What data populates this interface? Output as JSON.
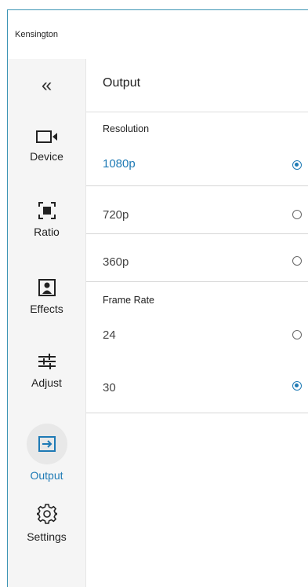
{
  "app": {
    "title": "Kensington"
  },
  "sidebar": {
    "collapse_glyph": "«",
    "items": [
      {
        "label": "Device",
        "icon": "camera-icon"
      },
      {
        "label": "Ratio",
        "icon": "ratio-icon"
      },
      {
        "label": "Effects",
        "icon": "portrait-icon"
      },
      {
        "label": "Adjust",
        "icon": "sliders-icon"
      },
      {
        "label": "Output",
        "icon": "output-icon",
        "active": true
      },
      {
        "label": "Settings",
        "icon": "gear-icon"
      }
    ]
  },
  "main": {
    "title": "Output",
    "resolution": {
      "label": "Resolution",
      "options": [
        {
          "label": "1080p",
          "selected": true
        },
        {
          "label": "720p",
          "selected": false
        },
        {
          "label": "360p",
          "selected": false
        }
      ]
    },
    "frame_rate": {
      "label": "Frame Rate",
      "options": [
        {
          "label": "24",
          "selected": false
        },
        {
          "label": "30",
          "selected": true
        }
      ]
    }
  },
  "colors": {
    "accent": "#1e7ab5",
    "frame_border": "#3e95b5"
  }
}
